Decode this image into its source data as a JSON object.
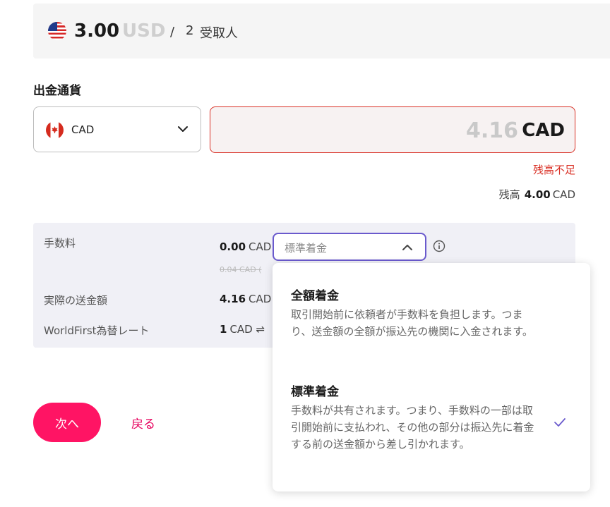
{
  "summary": {
    "amount": "3.00",
    "currency": "USD",
    "separator": "/",
    "recipient_count": "2",
    "recipient_label": "受取人",
    "flag_icon": "us-flag-icon"
  },
  "payout": {
    "section_title": "出金通貨",
    "currency_code": "CAD",
    "flag_icon": "canada-flag-icon",
    "amount_value": "4.16",
    "amount_unit": "CAD",
    "error_text": "残高不足",
    "balance_label": "残高",
    "balance_value": "4.00",
    "balance_currency": "CAD"
  },
  "fees": {
    "fee_label": "手数料",
    "fee_value": "0.00",
    "fee_currency": "CAD",
    "fee_original": "0.04 CAD (",
    "fee_type_selected": "標準着金",
    "actual_label": "実際の送金額",
    "actual_value": "4.16",
    "actual_currency": "CAD",
    "rate_label": "WorldFirst為替レート",
    "rate_value": "1",
    "rate_currency": "CAD",
    "rate_symbol": "⇌"
  },
  "dropdown": {
    "options": [
      {
        "title": "全額着金",
        "description": "取引開始前に依頼者が手数料を負担します。つまり、送金額の全額が振込先の機関に入金されます。",
        "selected": false
      },
      {
        "title": "標準着金",
        "description": "手数料が共有されます。つまり、手数料の一部は取引開始前に支払われ、その他の部分は振込先に着金する前の送金額から差し引かれます。",
        "selected": true
      }
    ]
  },
  "actions": {
    "next_label": "次へ",
    "back_label": "戻る"
  },
  "colors": {
    "accent": "#ff1464",
    "error": "#d93025",
    "focus": "#6a5acd"
  }
}
